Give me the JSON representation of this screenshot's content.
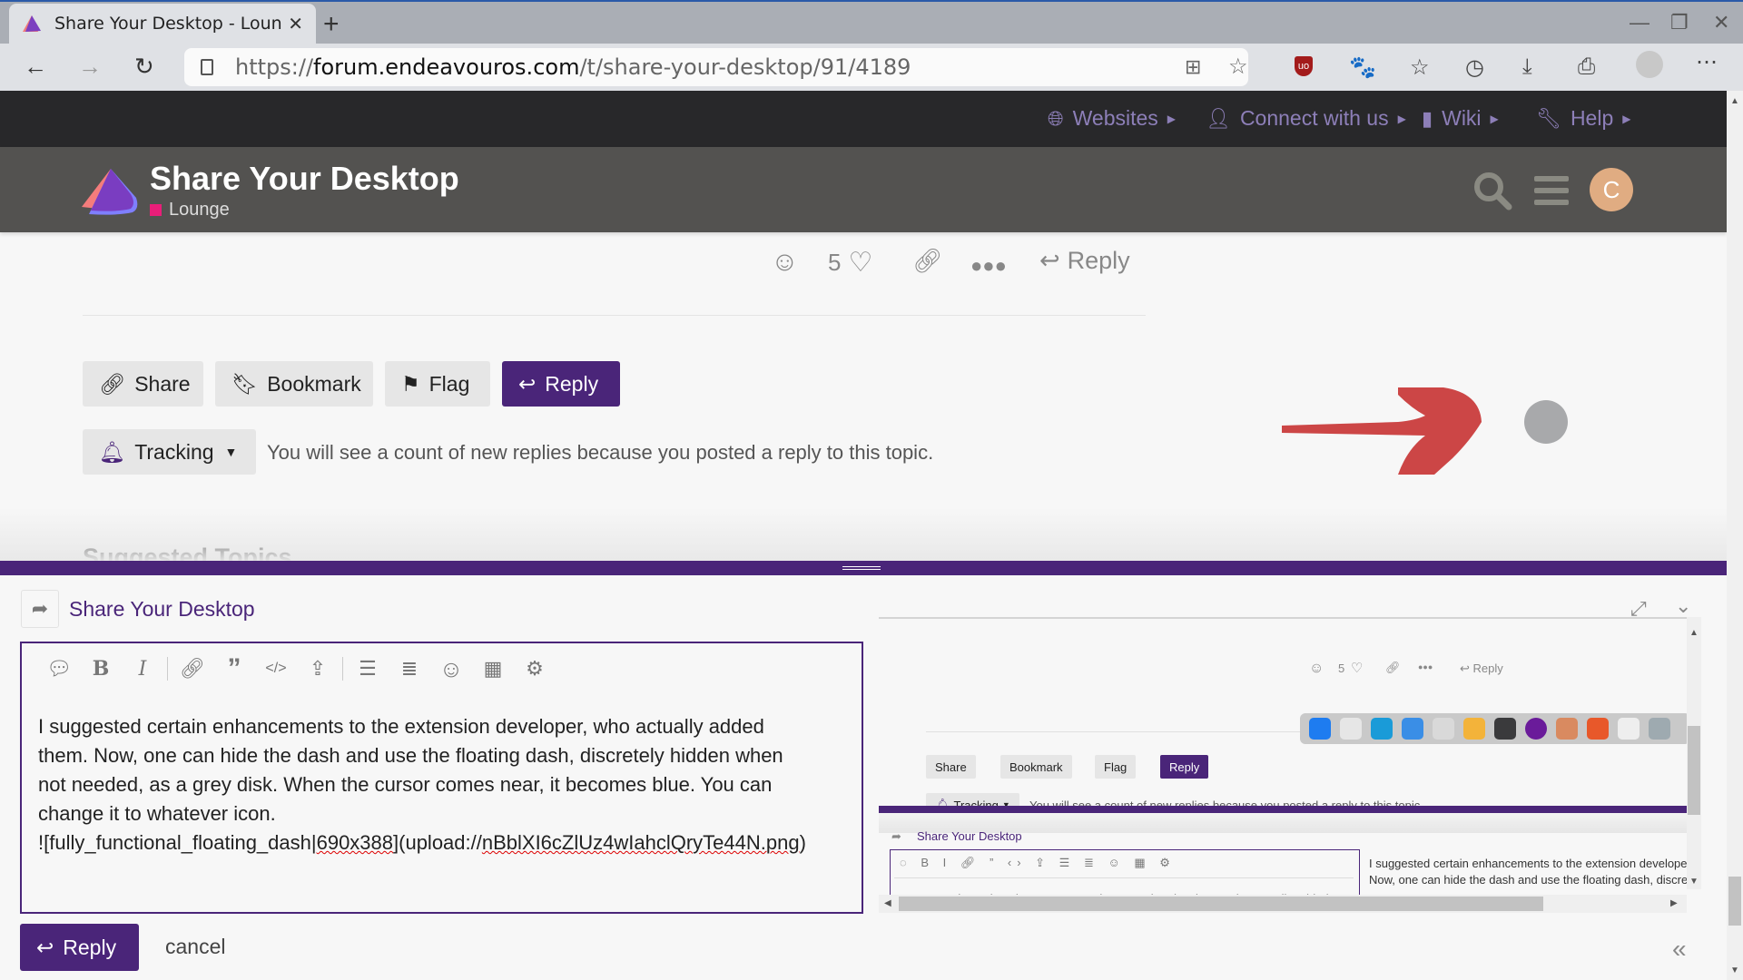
{
  "browser": {
    "tab_title": "Share Your Desktop - Lounge",
    "new_tab_label": "+",
    "url_scheme": "https://",
    "url_domain": "forum.endeavouros.com",
    "url_path": "/t/share-your-desktop/91/4189",
    "toolbar_icons": [
      "apps-add-icon",
      "favorite-add-icon",
      "ublock-shield-icon",
      "gnome-foot-icon",
      "favorites-icon",
      "history-icon",
      "downloads-icon",
      "screenshot-icon",
      "profile-icon",
      "more-icon"
    ]
  },
  "topnav": {
    "items": [
      {
        "label": "Websites",
        "icon": "globe-icon"
      },
      {
        "label": "Connect with us",
        "icon": "user-icon"
      },
      {
        "label": "Wiki",
        "icon": "book-icon"
      },
      {
        "label": "Help",
        "icon": "wrench-icon"
      }
    ]
  },
  "header": {
    "title": "Share Your Desktop",
    "category": "Lounge",
    "category_color": "#e91e79",
    "avatar_letter": "C",
    "avatar_color": "#e0ac82"
  },
  "post_actions": {
    "like_count": "5",
    "reply_label": "Reply"
  },
  "topic_footer": {
    "share_label": "Share",
    "bookmark_label": "Bookmark",
    "flag_label": "Flag",
    "reply_label": "Reply",
    "tracking_label": "Tracking",
    "tracking_text": "You will see a count of new replies because you posted a reply to this topic."
  },
  "suggested_heading": "Suggested Topics",
  "composer": {
    "title": "Share Your Desktop",
    "text_lines": [
      "I suggested certain enhancements to the extension developer, who actually added",
      "them. Now, one can hide the dash and use the floating dash, discretely hidden when",
      "not needed, as a grey disk. When the cursor comes near, it becomes blue. You can",
      "change it to whatever icon."
    ],
    "image_markup_prefix": "![fully_functional_floating_dash|",
    "image_markup_size": "690x388",
    "image_markup_mid": "](upload://",
    "image_markup_id": "nBblXI6cZlUz4wIahclQryTe44N.png",
    "image_markup_suffix": ")",
    "submit_label": "Reply",
    "cancel_label": "cancel"
  },
  "preview": {
    "like_count": "5",
    "reply_label": "Reply",
    "share_label": "Share",
    "bookmark_label": "Bookmark",
    "flag_label": "Flag",
    "tracking_label": "Tracking",
    "tracking_text": "You will see a count of new replies because you posted a reply to this topic.",
    "composer_title": "Share Your Desktop",
    "preview_line1": "I suggested certain enhancements to the extension develope",
    "preview_line2": "Now, one can hide the dash and use the floating dash, discre",
    "editor_line": "I suggested certain enhancements to the extension developer, who actually added",
    "dock_icons": [
      "app-store",
      "skype",
      "edge-dev",
      "finder",
      "calculator",
      "genie",
      "terminal",
      "tor-browser",
      "image-viewer",
      "firefox",
      "screenshot",
      "extensions"
    ],
    "dock_colors": [
      "#1e7cf0",
      "#e6e6e6",
      "#1a9bd8",
      "#3a8ee6",
      "#d9d9d9",
      "#f3b33a",
      "#3a3a3c",
      "#6a1b9a",
      "#d98a60",
      "#e8582a",
      "#eeeeee",
      "#9eaab0"
    ]
  }
}
